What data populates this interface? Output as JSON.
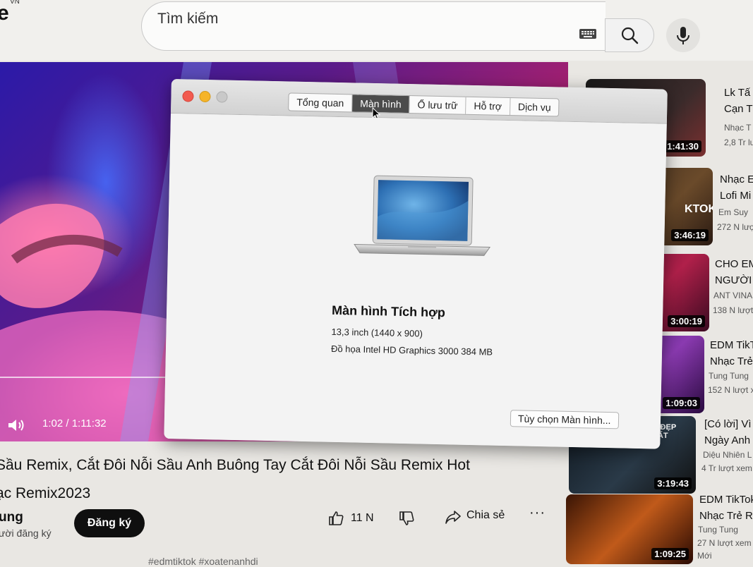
{
  "header": {
    "logo_letter": "e",
    "logo_region": "VN",
    "search_placeholder": "Tìm kiếm",
    "icons": {
      "keyboard": "keyboard-icon",
      "search": "search-icon",
      "mic": "mic-icon"
    }
  },
  "player": {
    "time": "1:02 / 1:11:32",
    "icons": {
      "volume": "volume-icon"
    }
  },
  "video": {
    "title_line1": "Sầu Remix, Cắt Đôi Nỗi Sầu Anh Buông Tay Cắt Đôi Nỗi Sầu Remix Hot",
    "title_line2": "ạc Remix2023",
    "channel": "ung",
    "subscribers": "ười đăng ký",
    "subscribe_label": "Đăng ký",
    "like_count": "11 N",
    "share_label": "Chia sẻ",
    "more_label": "···",
    "hashtags": "#edmtiktok #xoatenanhdi"
  },
  "sidebar": [
    {
      "title1": "Lk Tấ",
      "title2": "Cạn T",
      "channel": "Nhạc T",
      "views": "2,8 Tr lượt",
      "duration": "1:41:30",
      "thumb_text": ""
    },
    {
      "title1": "Nhạc E",
      "title2": "Lofi Mi",
      "channel": "Em Suy",
      "views": "272 N lượt",
      "duration": "3:46:19",
      "thumb_text": "KTOK"
    },
    {
      "title1": "CHO EM",
      "title2": "NGƯỜI E",
      "channel": "ANT VINA",
      "views": "138 N lượt",
      "duration": "3:00:19",
      "thumb_text": ""
    },
    {
      "title1": "EDM TikT",
      "title2": "Nhạc Trẻ",
      "channel": "Tung Tung",
      "views": "152 N lượt x",
      "duration": "1:09:03",
      "thumb_text": ""
    },
    {
      "title1": "[Có lời] Vì",
      "title2": "Ngày Anh N",
      "channel": "Diệu Nhiên L",
      "views": "4 Tr lượt xem",
      "duration": "3:19:43",
      "thumb_text": "EM ĐẸP NHẤT"
    },
    {
      "title1": "EDM TikTok",
      "title2": "Nhạc Trẻ Re",
      "channel": "Tung Tung",
      "views": "27 N lượt xem",
      "duration": "1:09:25",
      "thumb_text": "",
      "badge": "Mới"
    }
  ],
  "dialog": {
    "tabs": [
      "Tổng quan",
      "Màn hình",
      "Ổ lưu trữ",
      "Hỗ trợ",
      "Dịch vụ"
    ],
    "active_tab": "Màn hình",
    "display_name": "Màn hình Tích hợp",
    "display_size": "13,3 inch (1440 x 900)",
    "display_gpu": "Đồ họa Intel HD Graphics 3000 384 MB",
    "options_button": "Tùy chọn Màn hình...",
    "icons": {
      "laptop": "laptop-icon",
      "cursor": "cursor-icon"
    }
  }
}
